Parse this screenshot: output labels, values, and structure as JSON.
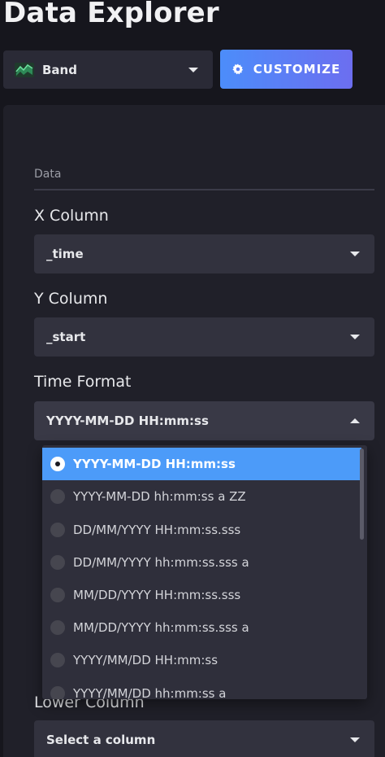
{
  "page": {
    "title": "Data Explorer"
  },
  "toolbar": {
    "vis_type": {
      "label": "Band",
      "icon": "band-graph-icon"
    },
    "customize": {
      "label": "CUSTOMIZE",
      "icon": "gear-icon"
    }
  },
  "panel": {
    "section": "Data",
    "fields": {
      "x_column": {
        "label": "X Column",
        "value": "_time"
      },
      "y_column": {
        "label": "Y Column",
        "value": "_start"
      },
      "time_format": {
        "label": "Time Format",
        "value": "YYYY-MM-DD HH:mm:ss"
      },
      "lower_column": {
        "label": "Lower Column",
        "value": "Select a column"
      }
    },
    "time_format_options": [
      "YYYY-MM-DD HH:mm:ss",
      "YYYY-MM-DD hh:mm:ss a ZZ",
      "DD/MM/YYYY HH:mm:ss.sss",
      "DD/MM/YYYY hh:mm:ss.sss a",
      "MM/DD/YYYY HH:mm:ss.sss",
      "MM/DD/YYYY hh:mm:ss.sss a",
      "YYYY/MM/DD HH:mm:ss",
      "YYYY/MM/DD hh:mm:ss a"
    ],
    "selected_option_index": 0
  },
  "colors": {
    "background": "#16161d",
    "panel": "#202029",
    "dropdown": "#32323e",
    "accent": "#4c9bf9",
    "button_gradient_start": "#4c8dfa",
    "button_gradient_end": "#6c6ef0",
    "band_icon": "#34b36b"
  }
}
